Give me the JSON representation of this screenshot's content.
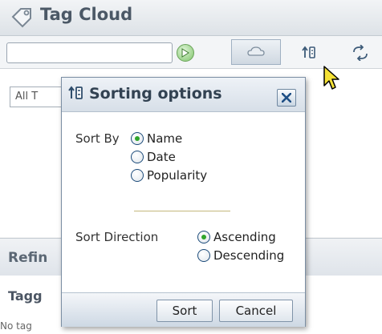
{
  "panel": {
    "title": "Tag Cloud",
    "icon": "tag-icon",
    "search": {
      "value": "",
      "placeholder": ""
    },
    "toolbar": [
      {
        "name": "cloud-view-button",
        "icon": "cloud-icon",
        "active": true
      },
      {
        "name": "sorting-options-button",
        "icon": "sort-icon",
        "active": false
      },
      {
        "name": "refresh-button",
        "icon": "refresh-icon",
        "active": false
      }
    ],
    "scope_select_value": "All T"
  },
  "refine": {
    "title": "Refin",
    "subtitle": "Tagg",
    "empty_text": "No tag"
  },
  "dialog": {
    "title": "Sorting options",
    "sort_by": {
      "label": "Sort By",
      "options": [
        {
          "label": "Name",
          "checked": true
        },
        {
          "label": "Date",
          "checked": false
        },
        {
          "label": "Popularity",
          "checked": false
        }
      ]
    },
    "sort_direction": {
      "label": "Sort Direction",
      "options": [
        {
          "label": "Ascending",
          "checked": true
        },
        {
          "label": "Descending",
          "checked": false
        }
      ]
    },
    "buttons": {
      "sort": "Sort",
      "cancel": "Cancel"
    }
  },
  "colors": {
    "title_text": "#4b5866",
    "radio_checked": "#2fa52b",
    "divider": "#c4b77c"
  }
}
